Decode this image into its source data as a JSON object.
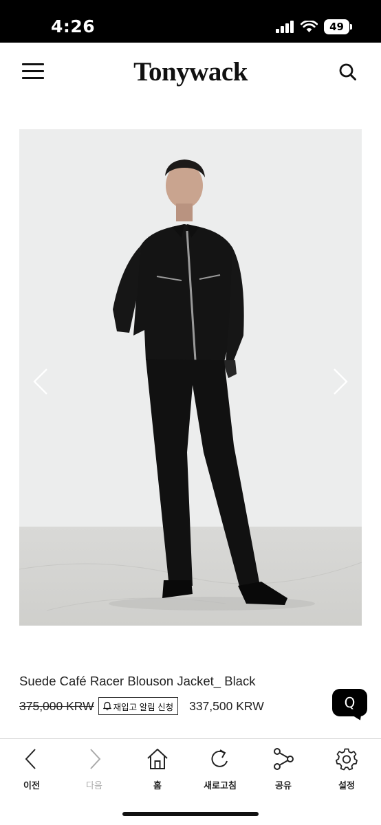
{
  "status_bar": {
    "time": "4:26",
    "battery": "49"
  },
  "header": {
    "logo": "Tonywack"
  },
  "product": {
    "name": "Suede Café Racer Blouson Jacket_ Black",
    "original_price": "375,000 KRW",
    "restock_label": "재입고 알림 신청",
    "sale_price": "337,500 KRW"
  },
  "chat": {
    "label": "Q"
  },
  "toolbar": {
    "items": [
      {
        "label": "이전",
        "icon": "chevron-left-icon",
        "enabled": true
      },
      {
        "label": "다음",
        "icon": "chevron-right-icon",
        "enabled": false
      },
      {
        "label": "홈",
        "icon": "home-icon",
        "enabled": true
      },
      {
        "label": "새로고침",
        "icon": "refresh-icon",
        "enabled": true
      },
      {
        "label": "공유",
        "icon": "share-icon",
        "enabled": true
      },
      {
        "label": "설정",
        "icon": "gear-icon",
        "enabled": true
      }
    ]
  }
}
